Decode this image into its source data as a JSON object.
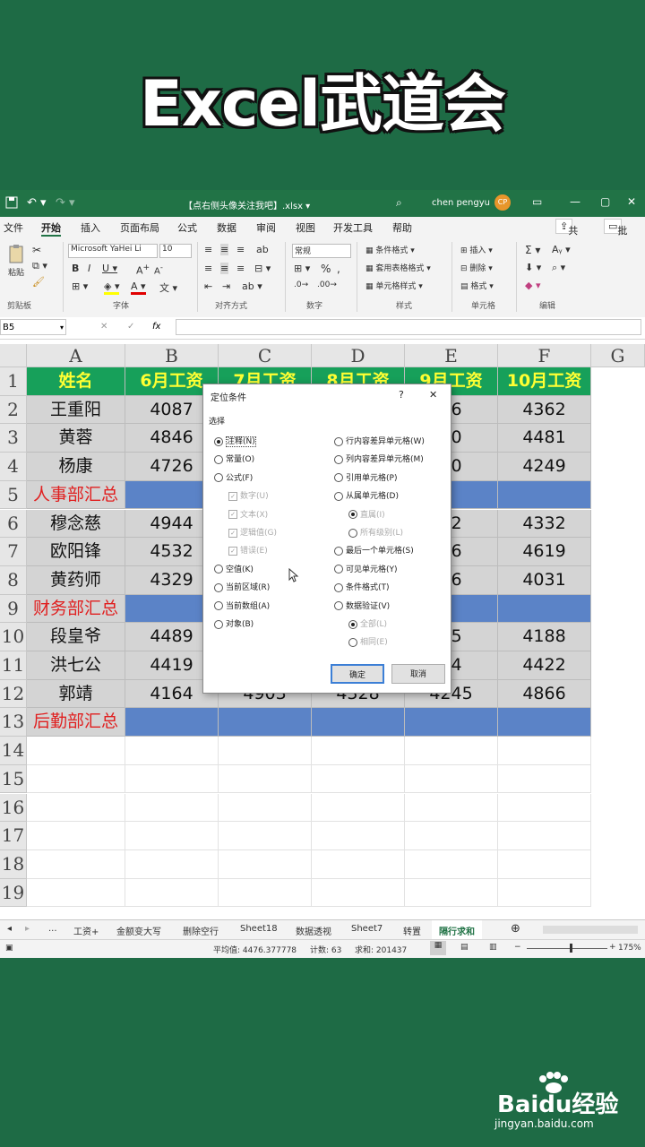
{
  "banner": "Excel武道会",
  "titlebar": {
    "file": "【点右侧头像关注我吧】.xlsx  ▾",
    "user": "chen pengyu",
    "avatar": "CP"
  },
  "menu": [
    "文件",
    "开始",
    "插入",
    "页面布局",
    "公式",
    "数据",
    "审阅",
    "视图",
    "开发工具",
    "帮助"
  ],
  "menu_right": {
    "share": "共享",
    "comment": "批注"
  },
  "ribbon": {
    "paste": "粘贴",
    "clipboard": "剪贴板",
    "font_name": "Microsoft YaHei Li",
    "font_size": "10",
    "font_group": "字体",
    "align_group": "对齐方式",
    "number_format": "常规",
    "number_group": "数字",
    "cond_format": "条件格式",
    "table_format": "套用表格格式",
    "cell_style": "单元格样式",
    "style_group": "样式",
    "insert": "插入",
    "delete": "删除",
    "format": "格式",
    "cells_group": "单元格",
    "edit_group": "编辑"
  },
  "formula_bar": {
    "namebox": "B5",
    "fx": "fx"
  },
  "columns": [
    "A",
    "B",
    "C",
    "D",
    "E",
    "F",
    "G"
  ],
  "rows": [
    "1",
    "2",
    "3",
    "4",
    "5",
    "6",
    "7",
    "8",
    "9",
    "10",
    "11",
    "12",
    "13",
    "14",
    "15",
    "16",
    "17",
    "18",
    "19"
  ],
  "table": {
    "header": [
      "姓名",
      "6月工资",
      "7月工资",
      "8月工资",
      "9月工资",
      "10月工资"
    ],
    "rows": [
      {
        "type": "data",
        "cells": [
          "王重阳",
          "4087",
          "",
          "",
          "36",
          "4362"
        ]
      },
      {
        "type": "data",
        "cells": [
          "黄蓉",
          "4846",
          "",
          "",
          "40",
          "4481"
        ]
      },
      {
        "type": "data",
        "cells": [
          "杨康",
          "4726",
          "",
          "",
          "60",
          "4249"
        ]
      },
      {
        "type": "sum",
        "cells": [
          "人事部汇总",
          "",
          "",
          "",
          "",
          ""
        ]
      },
      {
        "type": "data",
        "cells": [
          "穆念慈",
          "4944",
          "",
          "",
          "12",
          "4332"
        ]
      },
      {
        "type": "data",
        "cells": [
          "欧阳锋",
          "4532",
          "",
          "",
          "06",
          "4619"
        ]
      },
      {
        "type": "data",
        "cells": [
          "黄药师",
          "4329",
          "",
          "",
          "06",
          "4031"
        ]
      },
      {
        "type": "sum",
        "cells": [
          "财务部汇总",
          "",
          "",
          "",
          "",
          ""
        ]
      },
      {
        "type": "data",
        "cells": [
          "段皇爷",
          "4489",
          "",
          "",
          "25",
          "4188"
        ]
      },
      {
        "type": "data",
        "cells": [
          "洪七公",
          "4419",
          "",
          "",
          "14",
          "4422"
        ]
      },
      {
        "type": "data",
        "cells": [
          "郭靖",
          "4164",
          "4903",
          "4328",
          "4245",
          "4866"
        ]
      },
      {
        "type": "sum",
        "cells": [
          "后勤部汇总",
          "",
          "",
          "",
          "",
          ""
        ]
      }
    ]
  },
  "dialog": {
    "title": "定位条件",
    "help": "?",
    "close": "✕",
    "section": "选择",
    "left": [
      {
        "label": "注释(N)",
        "kind": "radio",
        "on": true
      },
      {
        "label": "常量(O)",
        "kind": "radio"
      },
      {
        "label": "公式(F)",
        "kind": "radio"
      },
      {
        "label": "数字(U)",
        "kind": "check",
        "sub": true
      },
      {
        "label": "文本(X)",
        "kind": "check",
        "sub": true
      },
      {
        "label": "逻辑值(G)",
        "kind": "check",
        "sub": true
      },
      {
        "label": "错误(E)",
        "kind": "check",
        "sub": true
      },
      {
        "label": "空值(K)",
        "kind": "radio"
      },
      {
        "label": "当前区域(R)",
        "kind": "radio"
      },
      {
        "label": "当前数组(A)",
        "kind": "radio"
      },
      {
        "label": "对象(B)",
        "kind": "radio"
      }
    ],
    "right": [
      {
        "label": "行内容差异单元格(W)",
        "kind": "radio"
      },
      {
        "label": "列内容差异单元格(M)",
        "kind": "radio"
      },
      {
        "label": "引用单元格(P)",
        "kind": "radio"
      },
      {
        "label": "从属单元格(D)",
        "kind": "radio"
      },
      {
        "label": "直属(I)",
        "kind": "radio",
        "sub": true,
        "on": true
      },
      {
        "label": "所有级别(L)",
        "kind": "radio",
        "sub": true
      },
      {
        "label": "最后一个单元格(S)",
        "kind": "radio"
      },
      {
        "label": "可见单元格(Y)",
        "kind": "radio"
      },
      {
        "label": "条件格式(T)",
        "kind": "radio"
      },
      {
        "label": "数据验证(V)",
        "kind": "radio"
      },
      {
        "label": "全部(L)",
        "kind": "radio",
        "sub": true,
        "on": true
      },
      {
        "label": "相同(E)",
        "kind": "radio",
        "sub": true
      }
    ],
    "ok": "确定",
    "cancel": "取消"
  },
  "sheet_tabs": [
    "...",
    "工资+",
    "金额变大写",
    "删除空行",
    "Sheet18",
    "数据透视",
    "Sheet7",
    "转置",
    "隔行求和"
  ],
  "status": {
    "avg": "平均值: 4476.377778",
    "count": "计数: 63",
    "sum": "求和: 201437",
    "zoom": "175%"
  },
  "watermark": {
    "brand": "Baidu经验",
    "url": "jingyan.baidu.com"
  }
}
